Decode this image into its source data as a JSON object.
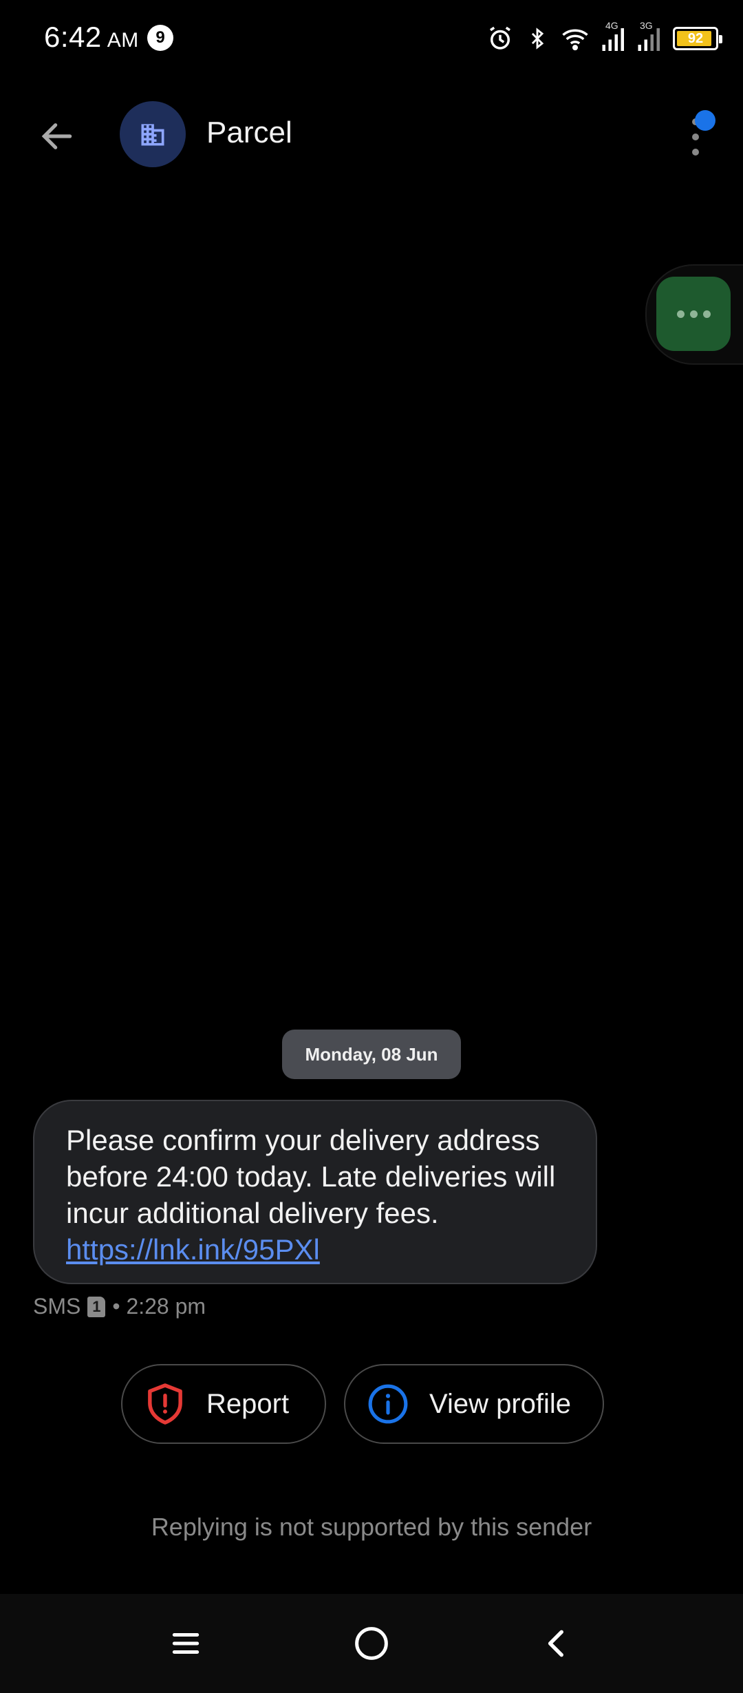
{
  "status_bar": {
    "time": "6:42",
    "ampm": "AM",
    "notification_count": "9",
    "network_1": "4G",
    "network_2": "3G",
    "battery": "92",
    "battery_level": 0.92,
    "battery_color": "#f2c21b"
  },
  "app_bar": {
    "contact_name": "Parcel",
    "avatar_icon": "building-icon",
    "back_icon": "arrow-left-icon",
    "more_icon": "more-vert-icon"
  },
  "floating_bubble": {
    "icon": "more-horiz-icon",
    "color": "#1e5a2e"
  },
  "conversation": {
    "date_label": "Monday, 08 Jun",
    "message": {
      "text": "Please confirm your delivery address before 24:00 today. Late deliveries will incur additional delivery fees. ",
      "link": "https://lnk.ink/95PXl",
      "type": "SMS",
      "sim": "1",
      "time": "• 2:28 pm"
    }
  },
  "actions": {
    "report_label": "Report",
    "view_profile_label": "View profile",
    "report_color": "#e53935",
    "profile_color": "#1a73e8"
  },
  "footer": {
    "reply_note": "Replying is not supported by this sender"
  },
  "nav": {
    "recents_icon": "menu-icon",
    "home_icon": "circle-home-icon",
    "back_icon": "chevron-left-icon"
  }
}
